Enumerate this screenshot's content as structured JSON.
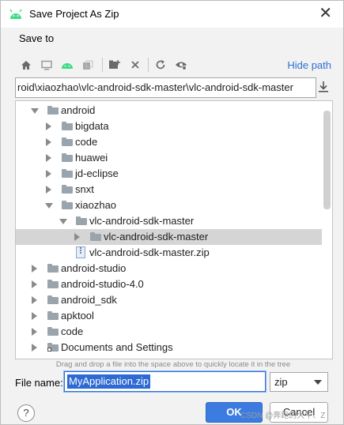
{
  "window": {
    "title": "Save Project As Zip",
    "close_glyph": "✕"
  },
  "save_to_label": "Save to",
  "toolbar": {
    "icons": [
      "home-icon",
      "desktop-icon",
      "android-icon",
      "module-icon",
      "new-folder-icon",
      "delete-icon",
      "refresh-icon",
      "show-hidden-icon"
    ],
    "hide_path_label": "Hide path"
  },
  "path": {
    "value": "roid\\xiaozhao\\vlc-android-sdk-master\\vlc-android-sdk-master"
  },
  "tree": {
    "items": [
      {
        "label": "android",
        "level": 0,
        "state": "expanded",
        "kind": "folder"
      },
      {
        "label": "bigdata",
        "level": 1,
        "state": "collapsed",
        "kind": "folder"
      },
      {
        "label": "code",
        "level": 1,
        "state": "collapsed",
        "kind": "folder"
      },
      {
        "label": "huawei",
        "level": 1,
        "state": "collapsed",
        "kind": "folder"
      },
      {
        "label": "jd-eclipse",
        "level": 1,
        "state": "collapsed",
        "kind": "folder"
      },
      {
        "label": "snxt",
        "level": 1,
        "state": "collapsed",
        "kind": "folder"
      },
      {
        "label": "xiaozhao",
        "level": 1,
        "state": "expanded",
        "kind": "folder"
      },
      {
        "label": "vlc-android-sdk-master",
        "level": 2,
        "state": "expanded",
        "kind": "folder"
      },
      {
        "label": "vlc-android-sdk-master",
        "level": 3,
        "state": "collapsed",
        "kind": "folder",
        "selected": true
      },
      {
        "label": "vlc-android-sdk-master.zip",
        "level": 2,
        "state": "leaf",
        "kind": "zip"
      },
      {
        "label": "android-studio",
        "level": 0,
        "state": "collapsed",
        "kind": "folder"
      },
      {
        "label": "android-studio-4.0",
        "level": 0,
        "state": "collapsed",
        "kind": "folder"
      },
      {
        "label": "android_sdk",
        "level": 0,
        "state": "collapsed",
        "kind": "folder"
      },
      {
        "label": "apktool",
        "level": 0,
        "state": "collapsed",
        "kind": "folder"
      },
      {
        "label": "code",
        "level": 0,
        "state": "collapsed",
        "kind": "folder"
      },
      {
        "label": "Documents and Settings",
        "level": 0,
        "state": "collapsed",
        "kind": "link-folder"
      }
    ]
  },
  "hint": "Drag and drop a file into the space above to quickly locate it in the tree",
  "file_name": {
    "label": "File name:",
    "value": "MyApplication.zip"
  },
  "extension": {
    "value": "zip"
  },
  "buttons": {
    "help": "?",
    "ok": "OK",
    "cancel": "Cancel"
  },
  "watermark": "CSDN @奔跑的大牛、Z",
  "colors": {
    "accent": "#3c7ce0",
    "link": "#2f6fd6",
    "selection": "#d5d5d5",
    "folder": "#9aa4ad",
    "android": "#3ddc84"
  }
}
